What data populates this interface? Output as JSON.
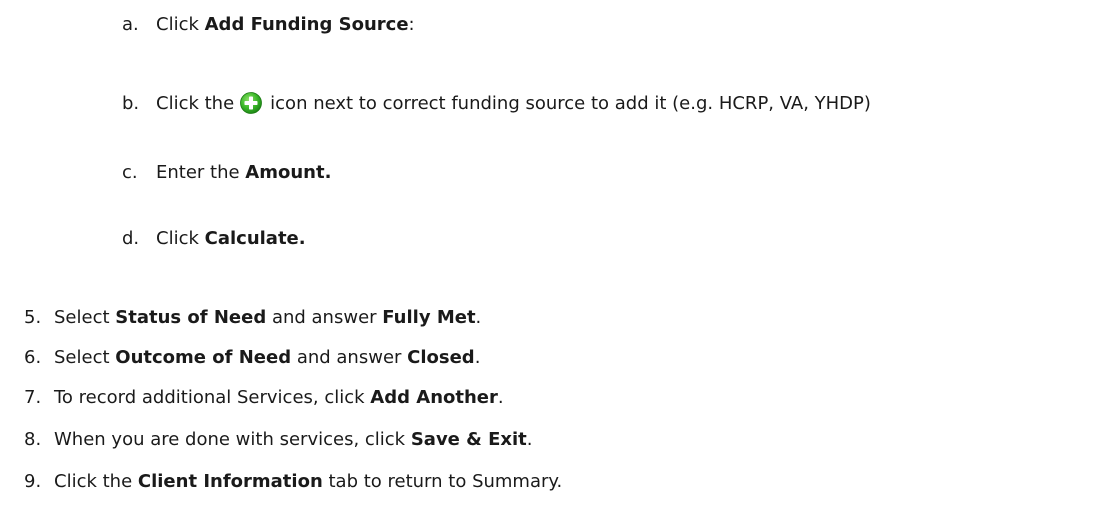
{
  "sub_steps": [
    {
      "marker": "a.",
      "pre": "Click ",
      "bold": "Add Funding Source",
      "post": ":"
    },
    {
      "marker": "b.",
      "pre": "Click the",
      "post": "icon next to correct funding source  to add it (e.g. HCRP, VA, YHDP)"
    },
    {
      "marker": "c.",
      "pre": "Enter the ",
      "bold": "Amount."
    },
    {
      "marker": "d.",
      "pre": "Click ",
      "bold": "Calculate."
    }
  ],
  "steps": [
    {
      "marker": "5.",
      "pre": "Select ",
      "bold1": "Status of Need",
      "mid": " and answer ",
      "bold2": "Fully Met",
      "post": "."
    },
    {
      "marker": "6.",
      "pre": "Select ",
      "bold1": "Outcome of Need",
      "mid": " and answer ",
      "bold2": "Closed",
      "post": "."
    },
    {
      "marker": "7.",
      "pre": "To record additional Services, click ",
      "bold": "Add Another",
      "post": "."
    },
    {
      "marker": "8.",
      "pre": "When you are done with services, click ",
      "bold": "Save & Exit",
      "post": "."
    },
    {
      "marker": "9.",
      "pre": "Click the ",
      "bold": "Client Information",
      "post": " tab to return to Summary."
    }
  ],
  "icons": {
    "add_icon": "green-plus-circle-icon",
    "add_icon_color": "#2fae1f"
  }
}
